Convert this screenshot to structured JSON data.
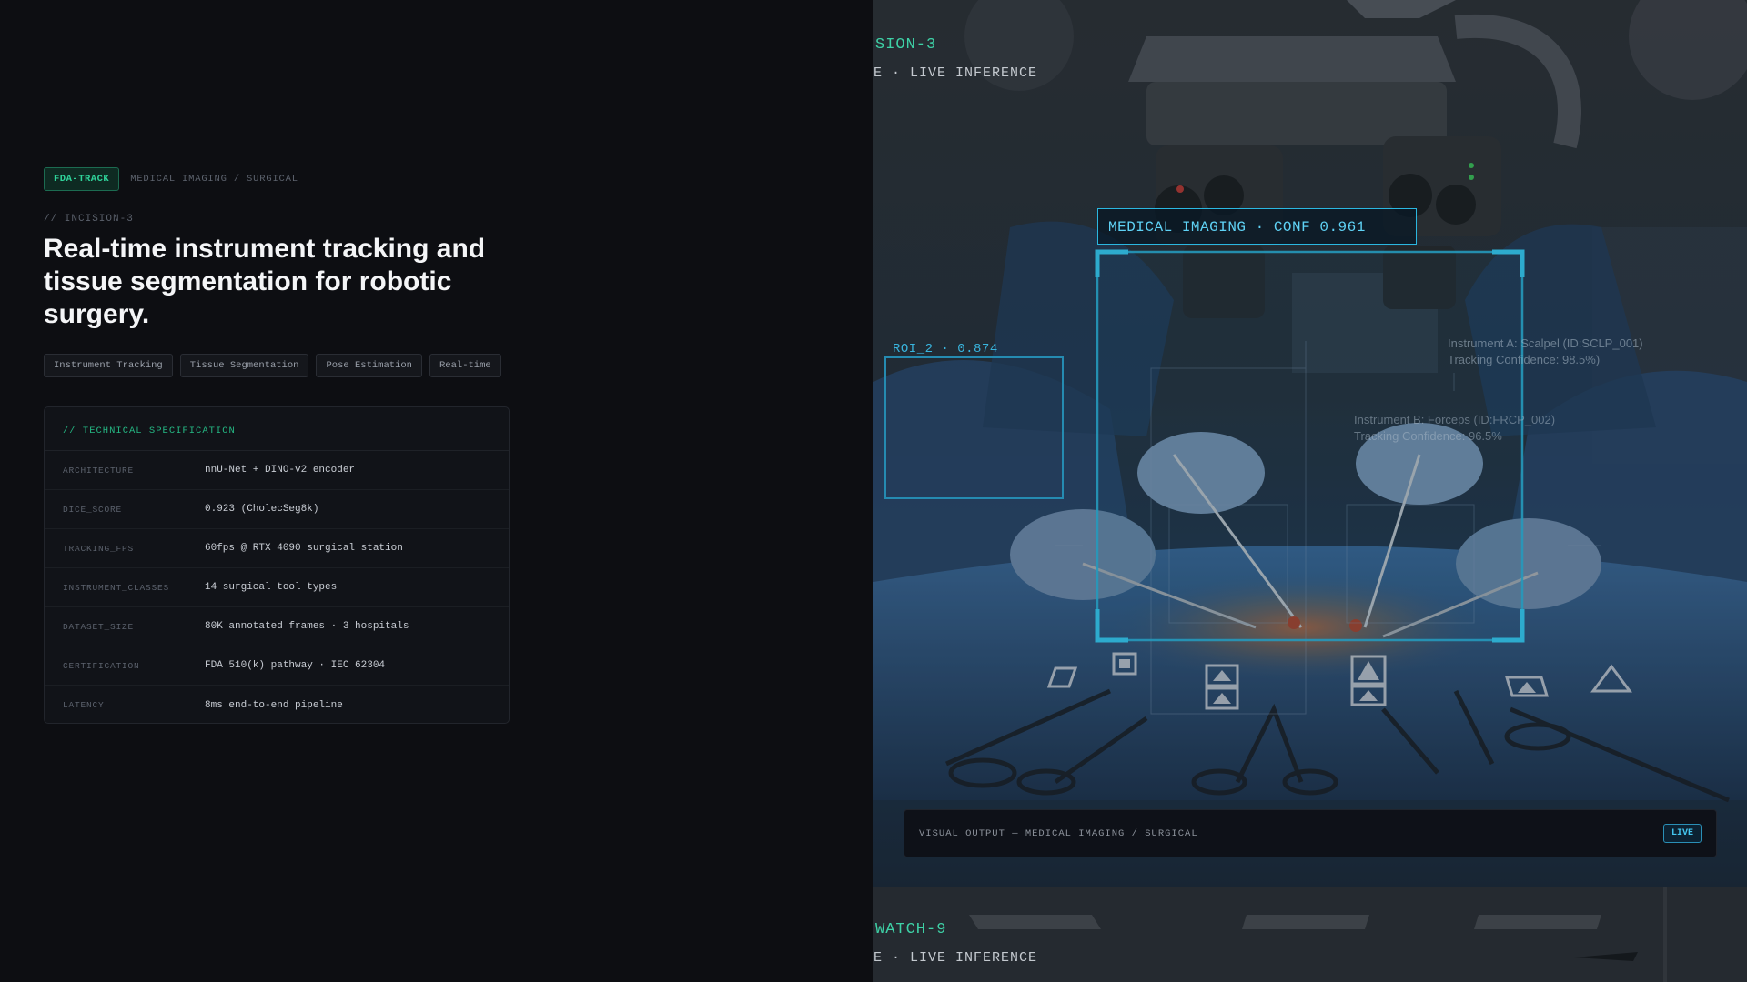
{
  "header": {
    "badge": "FDA-TRACK",
    "breadcrumb": "MEDICAL IMAGING / SURGICAL",
    "kicker": "// INCISION-3",
    "title": "Real-time instrument tracking and tissue segmentation for robotic surgery."
  },
  "tags": [
    "Instrument Tracking",
    "Tissue Segmentation",
    "Pose Estimation",
    "Real-time"
  ],
  "spec": {
    "heading": "// TECHNICAL SPECIFICATION",
    "rows": [
      {
        "key": "ARCHITECTURE",
        "value": "nnU-Net + DINO-v2 encoder"
      },
      {
        "key": "DICE_SCORE",
        "value": "0.923 (CholecSeg8k)"
      },
      {
        "key": "TRACKING_FPS",
        "value": "60fps @ RTX 4090 surgical station"
      },
      {
        "key": "INSTRUMENT_CLASSES",
        "value": "14 surgical tool types"
      },
      {
        "key": "DATASET_SIZE",
        "value": "80K annotated frames · 3 hospitals"
      },
      {
        "key": "CERTIFICATION",
        "value": "FDA 510(k) pathway · IEC 62304"
      },
      {
        "key": "LATENCY",
        "value": "8ms end-to-end pipeline"
      }
    ]
  },
  "visual": {
    "top_label": "SION-3",
    "top_sublabel": "E · LIVE INFERENCE",
    "detection_label": "MEDICAL IMAGING · CONF 0.961",
    "roi_label": "ROI_2 · 0.874",
    "ghost_text_1": [
      "Instrument A: Scalpel (ID:SCLP_001)",
      "Tracking Confidence: 98.5%)"
    ],
    "ghost_text_2": [
      "Instrument B: Forceps (ID:FRCP_002)",
      "Tracking Confidence: 96.5%"
    ],
    "output_text": "VISUAL OUTPUT — MEDICAL IMAGING / SURGICAL",
    "live_badge": "LIVE",
    "bottom_label": "WATCH-9",
    "bottom_sublabel": "E · LIVE INFERENCE"
  },
  "colors": {
    "accent_green": "#2fd39a",
    "accent_cyan": "#2bb7e0",
    "background": "#0d0e12"
  }
}
